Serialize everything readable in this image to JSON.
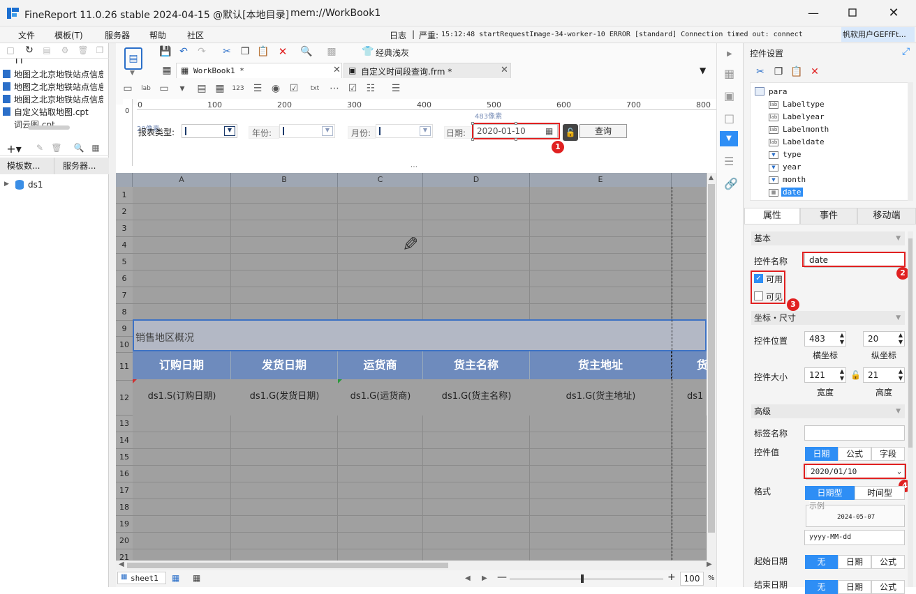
{
  "app": {
    "title": "FineReport 11.0.26 stable 2024-04-15 @默认[本地目录]",
    "workbook": "mem://WorkBook1"
  },
  "menu": [
    "文件",
    "模板(T)",
    "服务器",
    "帮助",
    "社区"
  ],
  "status": {
    "log_label": "日志",
    "separator": "|",
    "severity": "严重:",
    "message": "15:12:48 startRequestImage-34-worker-10 ERROR [standard] Connection timed out: connect",
    "user": "帆软用户GEFfFt..."
  },
  "left": {
    "files": [
      "TT",
      "地图之北京地铁站点信息",
      "地图之北京地铁站点信息",
      "地图之北京地铁站点信息",
      "自定义钻取地图.cpt",
      "词云图.cpt"
    ],
    "tabs": [
      "模板数...",
      "服务器..."
    ],
    "datasource": "ds1"
  },
  "toolbar": {
    "theme": "经典浅灰"
  },
  "tabs": [
    {
      "label": "WorkBook1 *"
    },
    {
      "label": "自定义时间段查询.frm *"
    }
  ],
  "ruler": {
    "ticks": [
      "0",
      "100",
      "200",
      "300",
      "400",
      "500",
      "600",
      "700",
      "800"
    ],
    "vertical_label": "0",
    "x_hint": "483像素",
    "y_hint": "20像素"
  },
  "params": {
    "type_label": "报表类型:",
    "year_label": "年份:",
    "month_label": "月份:",
    "date_label": "日期:",
    "date_value": "2020-01-10",
    "query_button": "查询"
  },
  "grid": {
    "columns": [
      "A",
      "B",
      "C",
      "D",
      "E"
    ],
    "rows": [
      "1",
      "2",
      "3",
      "4",
      "5",
      "6",
      "7",
      "8",
      "9",
      "10",
      "11",
      "12",
      "13",
      "14",
      "15",
      "16",
      "17",
      "18",
      "19",
      "20",
      "21"
    ],
    "title": "销售地区概况",
    "headers": [
      "订购日期",
      "发货日期",
      "运货商",
      "货主名称",
      "货主地址",
      "货"
    ],
    "cells": [
      "ds1.S(订购日期)",
      "ds1.G(发货日期)",
      "ds1.G(运货商)",
      "ds1.G(货主名称)",
      "ds1.G(货主地址)",
      "ds1"
    ]
  },
  "sheet": {
    "name": "sheet1",
    "zoom": "100",
    "zoom_unit": "%"
  },
  "right": {
    "title": "控件设置",
    "tree_root": "para",
    "tree": [
      {
        "label": "Labeltype",
        "kind": "label"
      },
      {
        "label": "Labelyear",
        "kind": "label"
      },
      {
        "label": "Labelmonth",
        "kind": "label"
      },
      {
        "label": "Labeldate",
        "kind": "label"
      },
      {
        "label": "type",
        "kind": "combo"
      },
      {
        "label": "year",
        "kind": "combo"
      },
      {
        "label": "month",
        "kind": "combo"
      },
      {
        "label": "date",
        "kind": "date",
        "selected": true
      }
    ],
    "tabs": [
      "属性",
      "事件",
      "移动端"
    ],
    "basic_section": "基本",
    "name_label": "控件名称",
    "name_value": "date",
    "enabled_label": "可用",
    "enabled": true,
    "visible_label": "可见",
    "visible": false,
    "pos_section": "坐标・尺寸",
    "pos_label": "控件位置",
    "x_value": "483",
    "y_value": "20",
    "x_caption": "横坐标",
    "y_caption": "纵坐标",
    "size_label": "控件大小",
    "w_value": "121",
    "h_value": "21",
    "w_caption": "宽度",
    "h_caption": "高度",
    "adv_section": "高级",
    "tag_label": "标签名称",
    "value_label": "控件值",
    "value_modes": [
      "日期",
      "公式",
      "字段"
    ],
    "value_date": "2020/01/10",
    "format_label": "格式",
    "format_modes": [
      "日期型",
      "时间型"
    ],
    "example_label": "示例",
    "example_value": "2024-05-07",
    "format_pattern": "yyyy-MM-dd",
    "start_label": "起始日期",
    "start_modes": [
      "无",
      "日期",
      "公式"
    ],
    "end_label": "结束日期",
    "end_modes": [
      "无",
      "日期",
      "公式"
    ]
  },
  "badges": [
    "1",
    "2",
    "3",
    "4"
  ],
  "colors": {
    "accent": "#2e8ef5",
    "highlight": "#e02020",
    "header_blue": "#6e8bbd"
  }
}
